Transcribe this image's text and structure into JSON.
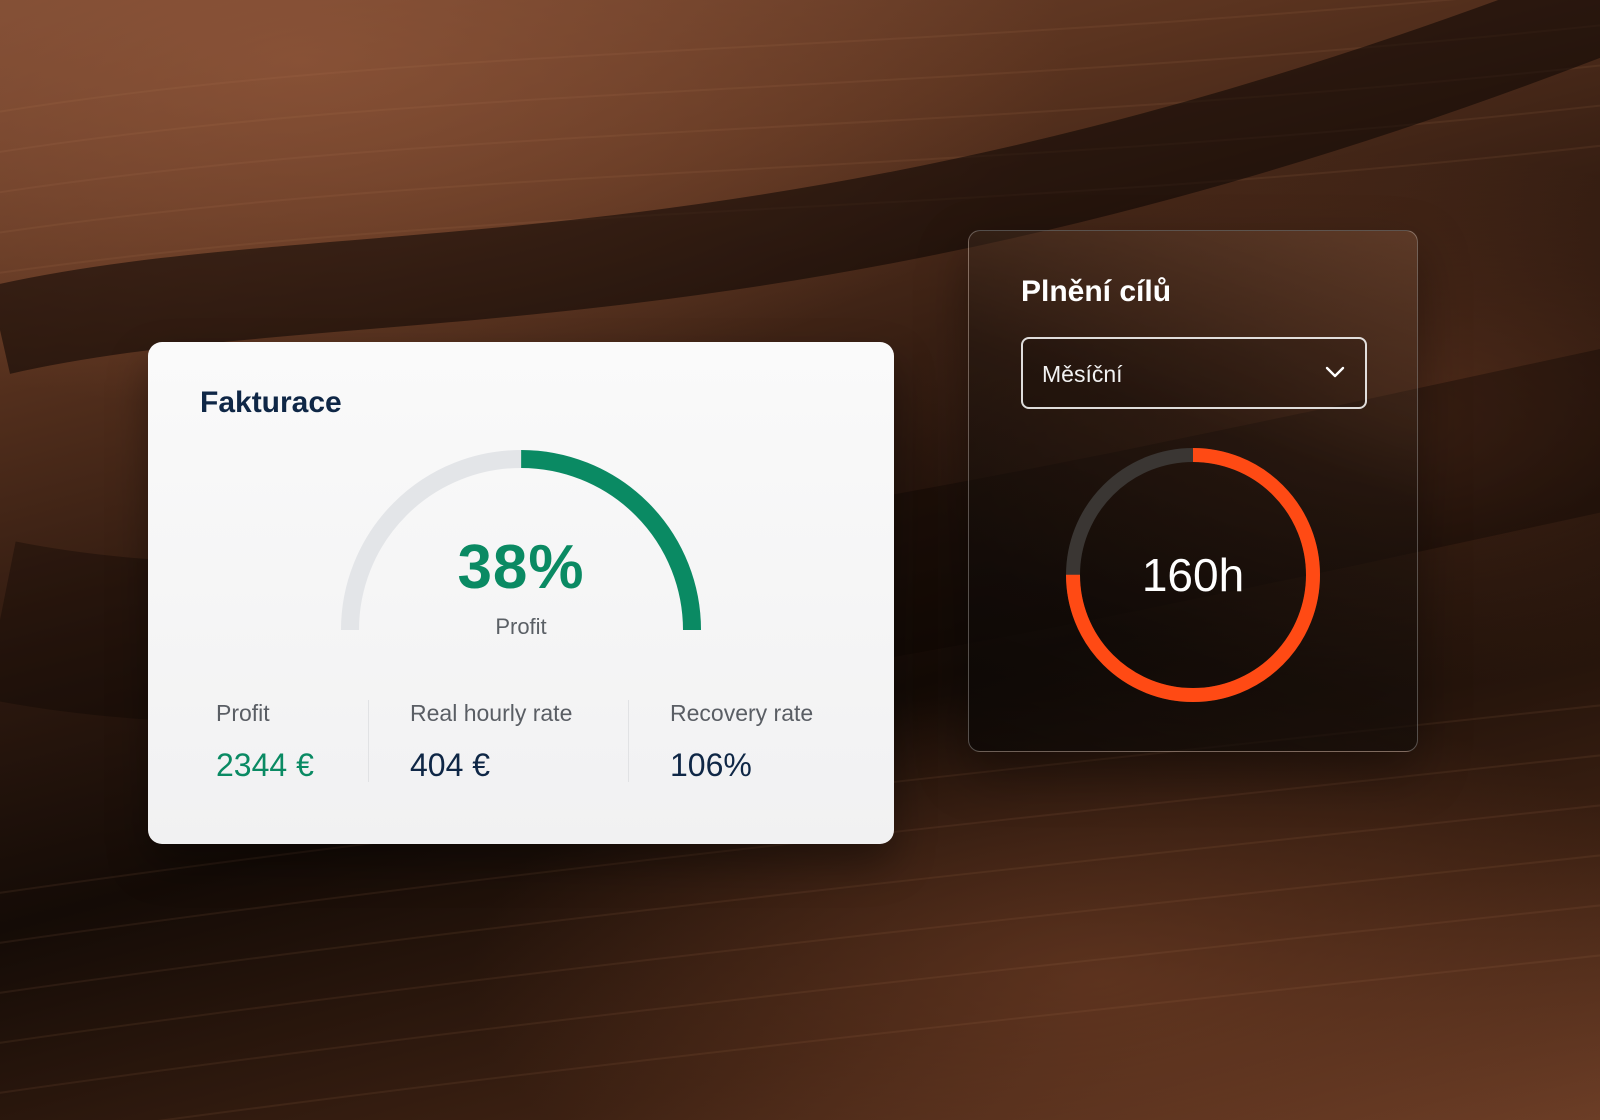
{
  "colors": {
    "profit_green": "#0a8a63",
    "gauge_track": "#e3e5e8",
    "goal_orange": "#ff4a14",
    "ring_track": "#3a3633",
    "navy_text": "#0f2746"
  },
  "fakturace": {
    "title": "Fakturace",
    "gauge": {
      "value_text": "38%",
      "caption": "Profit",
      "fill_fraction": 0.5
    },
    "stats": [
      {
        "label": "Profit",
        "value": "2344 €"
      },
      {
        "label": "Real hourly rate",
        "value": "404 €"
      },
      {
        "label": "Recovery rate",
        "value": "106%"
      }
    ]
  },
  "goals": {
    "title": "Plnění cílů",
    "period_select": {
      "selected": "Měsíční",
      "icon": "chevron-down-icon"
    },
    "ring": {
      "value_text": "160h",
      "fill_fraction": 0.75
    }
  }
}
